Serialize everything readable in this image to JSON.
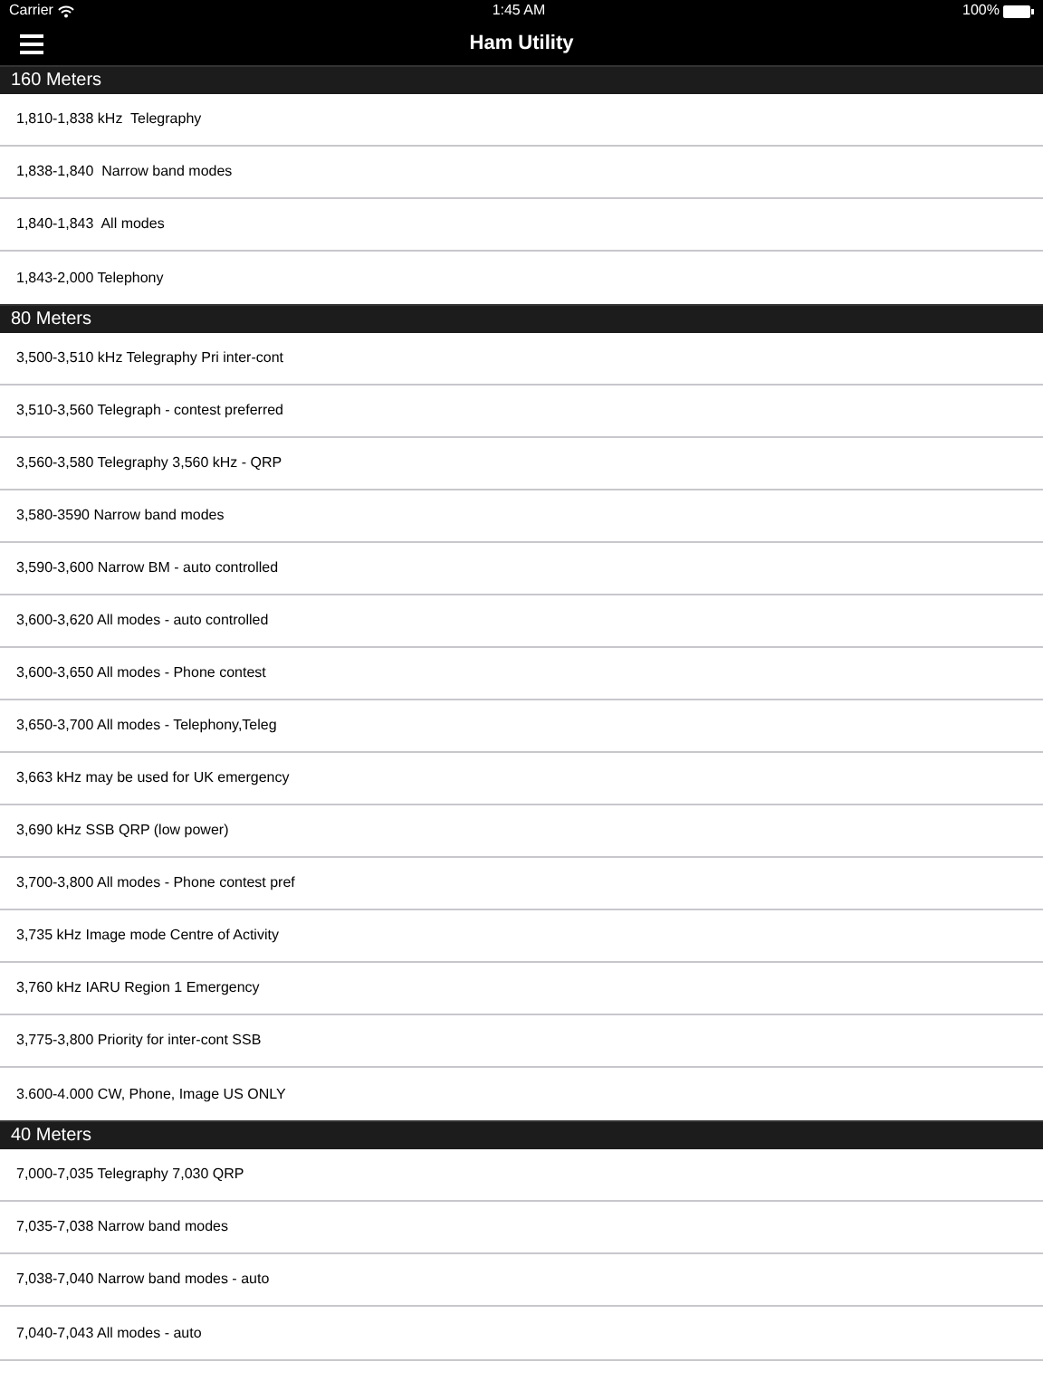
{
  "status_bar": {
    "carrier": "Carrier",
    "time": "1:45 AM",
    "battery": "100%"
  },
  "nav_bar": {
    "title": "Ham Utility"
  },
  "sections": [
    {
      "title": "160 Meters",
      "rows": [
        "1,810-1,838 kHz  Telegraphy",
        "1,838-1,840  Narrow band modes",
        "1,840-1,843  All modes",
        "1,843-2,000 Telephony"
      ]
    },
    {
      "title": "80 Meters",
      "rows": [
        "3,500-3,510 kHz Telegraphy Pri inter-cont",
        "3,510-3,560 Telegraph - contest preferred",
        "3,560-3,580 Telegraphy 3,560 kHz - QRP",
        "3,580-3590 Narrow band modes",
        "3,590-3,600 Narrow BM - auto controlled",
        "3,600-3,620 All modes - auto controlled",
        "3,600-3,650 All modes - Phone contest",
        "3,650-3,700 All modes - Telephony,Teleg",
        "3,663 kHz may be used for UK emergency",
        "3,690 kHz SSB QRP (low power)",
        "3,700-3,800 All modes - Phone contest pref",
        "3,735 kHz Image mode Centre of Activity",
        "3,760 kHz IARU Region 1 Emergency",
        "3,775-3,800 Priority for inter-cont SSB",
        "3.600-4.000 CW, Phone, Image US ONLY"
      ]
    },
    {
      "title": "40 Meters",
      "rows": [
        "7,000-7,035 Telegraphy 7,030 QRP",
        "7,035-7,038 Narrow band modes",
        "7,038-7,040 Narrow band modes - auto",
        "7,040-7,043 All modes - auto"
      ]
    }
  ]
}
